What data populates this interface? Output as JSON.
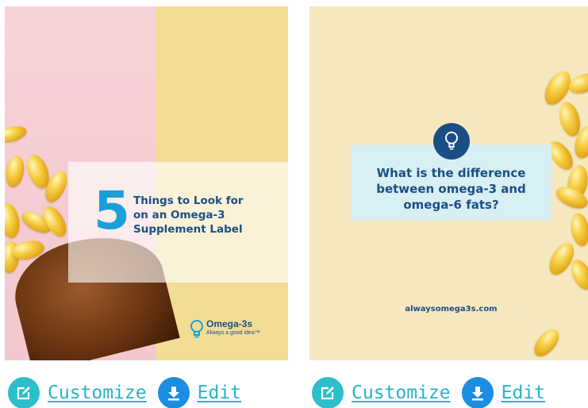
{
  "cards": [
    {
      "number": "5",
      "title_lines": [
        "Things to Look for",
        "on an Omega-3",
        "Supplement Label"
      ],
      "logo": {
        "name": "Omega-3s",
        "tagline": "Always a good idea™",
        "icon": "lightbulb-icon"
      },
      "actions": {
        "customize_label": "Customize",
        "edit_label": "Edit",
        "customize_icon": "edit-icon",
        "edit_icon": "download-icon"
      }
    },
    {
      "title_lines": [
        "What is the difference",
        "between omega-3 and",
        "omega-6 fats?"
      ],
      "icon": "lightbulb-icon",
      "url": "alwaysomega3s.com",
      "actions": {
        "customize_label": "Customize",
        "edit_label": "Edit",
        "customize_icon": "edit-icon",
        "edit_icon": "download-icon"
      }
    }
  ],
  "colors": {
    "brand_navy": "#1c4e86",
    "brand_blue": "#1a9fd9",
    "action_teal": "#2bbfc9",
    "action_blue": "#1a8ee3",
    "link": "#2ab3c4"
  }
}
